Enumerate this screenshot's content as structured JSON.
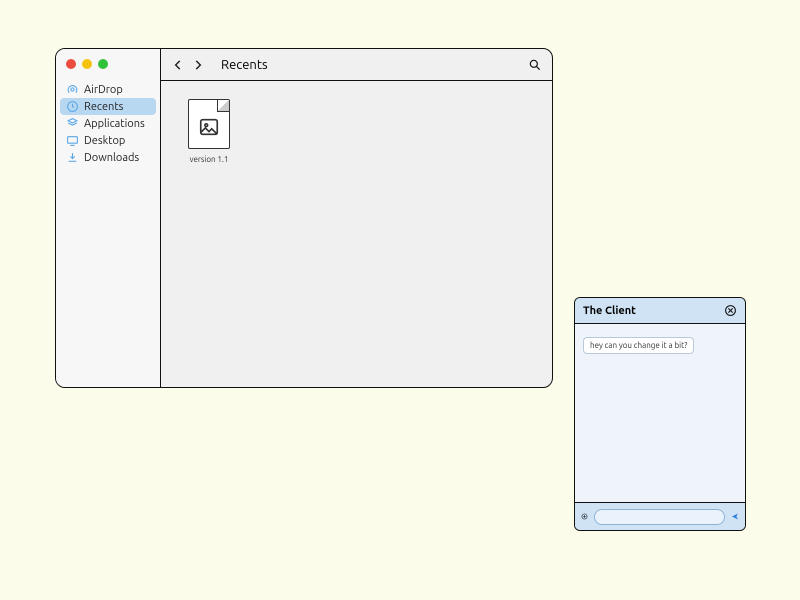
{
  "finder": {
    "toolbar": {
      "title": "Recents"
    },
    "sidebar": {
      "items": [
        {
          "label": "AirDrop",
          "icon": "airdrop-icon",
          "selected": false
        },
        {
          "label": "Recents",
          "icon": "clock-icon",
          "selected": true
        },
        {
          "label": "Applications",
          "icon": "app-icon",
          "selected": false
        },
        {
          "label": "Desktop",
          "icon": "desktop-icon",
          "selected": false
        },
        {
          "label": "Downloads",
          "icon": "download-icon",
          "selected": false
        }
      ]
    },
    "files": [
      {
        "name": "version 1.1"
      }
    ]
  },
  "chat": {
    "title": "The Client",
    "messages": [
      {
        "text": "hey can you change it a bit?"
      }
    ],
    "input": {
      "placeholder": ""
    }
  }
}
